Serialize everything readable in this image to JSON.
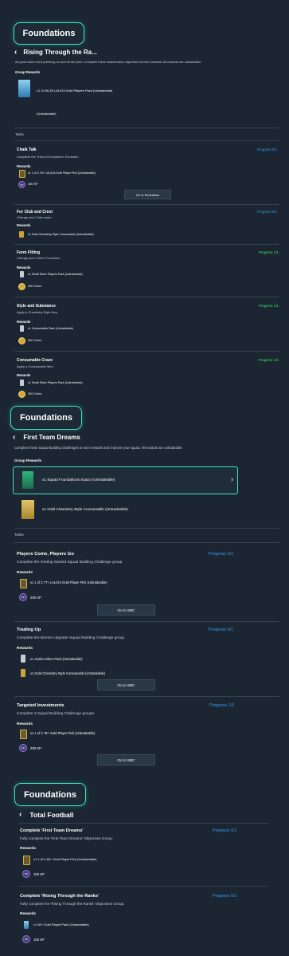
{
  "section1": {
    "badge": "Foundations",
    "title": "Rising Through the Ra...",
    "description": "All good clubs need polishing on and off the pitch. Complete these maintenance objectives to earn rewards. All rewards are untradeable.",
    "group_rewards_label": "Group Rewards",
    "group_reward_1": "x1 2x 80-83 LALIGA Gold Players Pack (Untradeable)",
    "group_reward_2": "(Untradeable)",
    "tasks_label": "Tasks",
    "tasks": [
      {
        "title": "Chalk Talk",
        "progress": "Progress 0/1",
        "desc": "Complete the \"Intro to Evolutions\" Evolution.",
        "rewards_label": "Rewards",
        "reward1": "x1 1 of 2 78+ LALIGA Gold Player Pick (Untradeable)",
        "reward2": "250 SP",
        "button": "Go to Evolutions"
      },
      {
        "title": "For Club and Crest",
        "progress": "Progress 0/1",
        "desc": "Change your Club name.",
        "rewards_label": "Rewards",
        "reward1": "x1 Gold Chemistry Style Consumable (Untradeable)"
      },
      {
        "title": "Form Fitting",
        "progress": "Progress 1/1",
        "desc": "Change your Club's Formation.",
        "rewards_label": "Rewards",
        "reward1": "x1 Small Silver Players Pack (Untradeable)",
        "reward2": "200 Coins"
      },
      {
        "title": "Style and Substance",
        "progress": "Progress 1/1",
        "desc": "Apply a Chemistry Style item.",
        "rewards_label": "Rewards",
        "reward1": "x1 Consumable Pack (Untradeable)",
        "reward2": "200 Coins"
      },
      {
        "title": "Consumable Craze",
        "progress": "Progress 1/1",
        "desc": "Apply a Consumable item.",
        "rewards_label": "Rewards",
        "reward1": "x1 Small Silver Players Pack (Untradeable)",
        "reward2": "200 Coins"
      }
    ]
  },
  "section2": {
    "badge": "Foundations",
    "title": "First Team Dreams",
    "description": "Complete these Squad Building Challenges to earn rewards and improve your squad. All rewards are untradeable.",
    "group_rewards_label": "Group Rewards",
    "group_reward_1": "x1 Squad Foundations Suazo (Untradeable)",
    "group_reward_2": "x1 Gold Chemistry Style Consumable (Untradeable)",
    "tasks_label": "Tasks",
    "tasks": [
      {
        "title": "Players Come, Players Go",
        "progress": "Progress 0/1",
        "desc": "Complete the Getting Started Squad Building Challenge group.",
        "rewards_label": "Rewards",
        "reward1": "x1 1 of 2 77+ LALIGA Gold Player Pick (Untradeable)",
        "reward2": "200 SP",
        "button": "Go to SBC"
      },
      {
        "title": "Trading Up",
        "progress": "Progress 0/1",
        "desc": "Complete the Bronze Upgrade Squad Building Challenge group.",
        "rewards_label": "Rewards",
        "reward1": "x1 Jumbo Silver Pack (Untradeable)",
        "reward2": "x1 Gold Chemistry Style Consumable (Untradeable)",
        "button": "Go to SBC"
      },
      {
        "title": "Targeted Investments",
        "progress": "Progress 1/3",
        "desc": "Complete 3 Squad Building Challenge groups.",
        "rewards_label": "Rewards",
        "reward1": "x1 1 of 2 78+ Gold Player Pick (Untradeable)",
        "reward2": "200 SP",
        "button": "Go to SBC"
      }
    ]
  },
  "section3": {
    "badge": "Foundations",
    "title": "Total Football",
    "tasks": [
      {
        "title": "Complete 'First Team Dreams'",
        "progress": "Progress 0/1",
        "desc": "Fully complete the 'First Team Dreams' Objectives Group.",
        "rewards_label": "Rewards",
        "reward1": "x1 1 of 2 80+ Gold Player Pick (Untradeable)",
        "reward2": "100 SP"
      },
      {
        "title": "Complete 'Rising Through the Ranks'",
        "progress": "Progress 0/1",
        "desc": "Fully complete the 'Rising Through the Ranks' Objectives Group.",
        "rewards_label": "Rewards",
        "reward1": "x1 82+ Gold Player Pack (Untradeable)",
        "reward2": "100 SP"
      }
    ]
  },
  "colors": {
    "background": "#1b2632",
    "accent": "#3fe3c0",
    "progress_complete": "#3ee86c",
    "progress_pending": "#3a9cf0"
  },
  "icons": {
    "back": "chevron-left-icon",
    "next": "chevron-right-icon",
    "coin": "coin-icon",
    "sp": "sp-icon"
  }
}
